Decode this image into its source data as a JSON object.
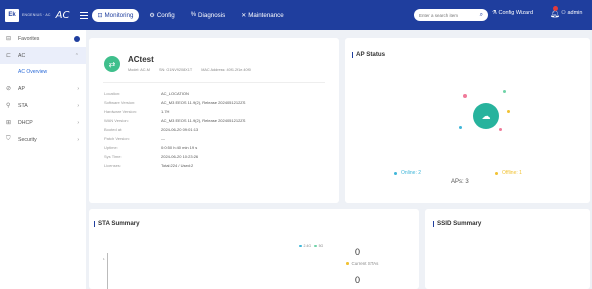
{
  "header": {
    "logo": "Ek",
    "brand_sub": "ENGENIUS · AC",
    "product": "AC",
    "tabs": [
      {
        "label": "Monitoring",
        "icon": "dashboard-icon",
        "active": true
      },
      {
        "label": "Config",
        "icon": "gear-icon",
        "active": false
      },
      {
        "label": "Diagnosis",
        "icon": "wrench-icon",
        "active": false
      },
      {
        "label": "Maintenance",
        "icon": "tools-icon",
        "active": false
      }
    ],
    "search_placeholder": "Enter a search item",
    "config_wizard": "Config Wizard",
    "admin": "admin"
  },
  "sidebar": {
    "items": [
      {
        "label": "Favorites",
        "icon": "star-icon"
      },
      {
        "label": "AC",
        "icon": "ac-icon",
        "selected": true
      },
      {
        "label": "AC Overview",
        "sub": true
      },
      {
        "label": "AP",
        "icon": "ap-icon"
      },
      {
        "label": "STA",
        "icon": "user-icon"
      },
      {
        "label": "DHCP",
        "icon": "network-icon"
      },
      {
        "label": "Security",
        "icon": "shield-icon"
      }
    ]
  },
  "ac_card": {
    "name": "ACtest",
    "model": "Model: AC-M",
    "sn": "SN: G1NV9208X1T",
    "mac": "MAC Address: 40f1.2f1e.40f0",
    "rows": [
      {
        "key": "Location:",
        "value": "AC_LOCATION"
      },
      {
        "key": "Software Version:",
        "value": "AC_M3 EEOS 11.9(2), Release 2024051212ZS"
      },
      {
        "key": "Hardware Version:",
        "value": "1.7H"
      },
      {
        "key": "WAN Version:",
        "value": "AC_M3 EEOS 11.9(2), Release 2024051212ZS"
      },
      {
        "key": "Booted at:",
        "value": "2024-06-20 09:01:13"
      },
      {
        "key": "Patch Version:",
        "value": "—"
      },
      {
        "key": "Uptime:",
        "value": "0:0:50 h:40 min 19 s"
      },
      {
        "key": "Sys Time:",
        "value": "2024-06-20 10:23:26"
      },
      {
        "key": "Licenses:",
        "value": "Total:224 / Used:2"
      }
    ]
  },
  "ap_status": {
    "title": "AP Status",
    "aps_label": "APs: 3",
    "online_label": "Online: 2",
    "offline_label": "Offline: 1",
    "online_color": "#3fb6d9",
    "offline_color": "#f1c232",
    "accent": "#27b39d"
  },
  "sta_summary": {
    "title": "STA Summary",
    "legend_24": "2.4G",
    "legend_5": "5G",
    "axis_tick": "1",
    "current_count": "0",
    "current_label": "Current STAs",
    "second_count": "0"
  },
  "ssid_summary": {
    "title": "SSID Summary"
  }
}
